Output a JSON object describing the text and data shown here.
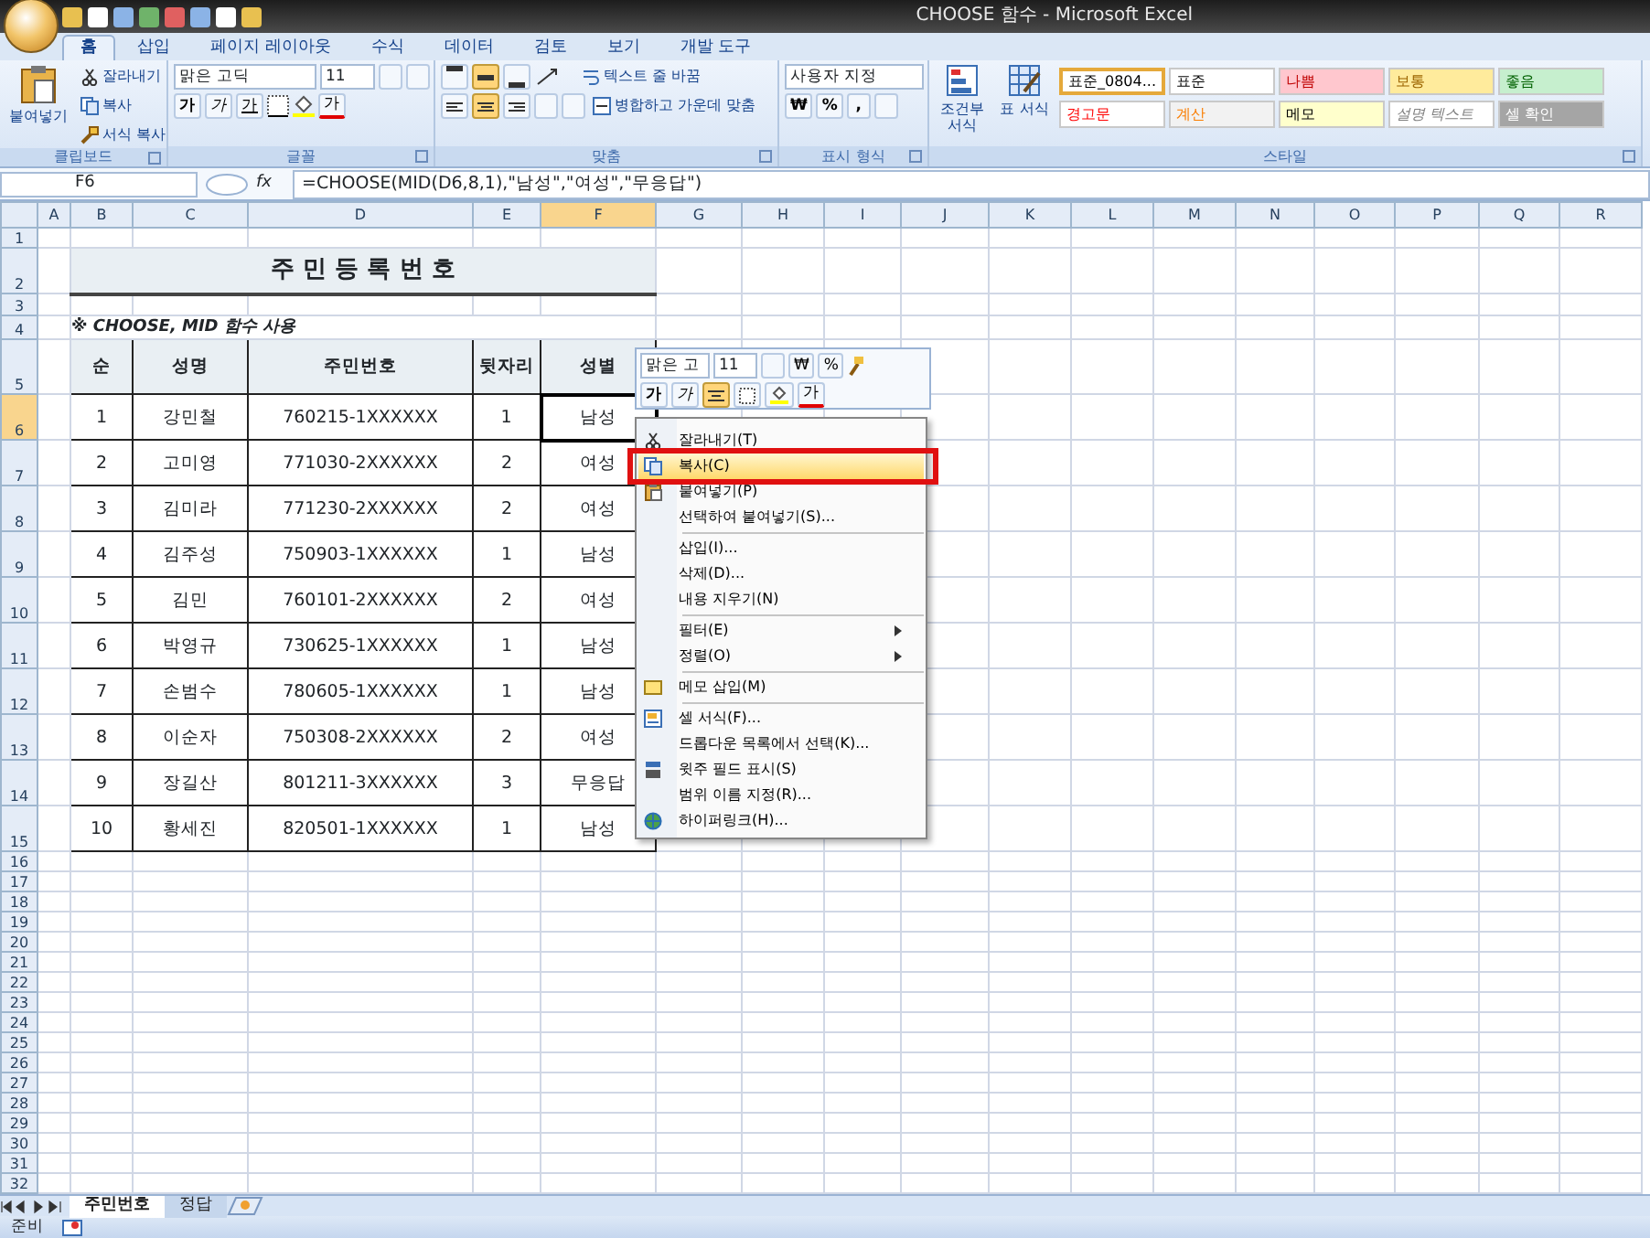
{
  "window": {
    "title": "CHOOSE 함수 - Microsoft Excel"
  },
  "ribbon_tabs": [
    {
      "label": "홈",
      "selected": true
    },
    {
      "label": "삽입",
      "selected": false
    },
    {
      "label": "페이지 레이아웃",
      "selected": false
    },
    {
      "label": "수식",
      "selected": false
    },
    {
      "label": "데이터",
      "selected": false
    },
    {
      "label": "검토",
      "selected": false
    },
    {
      "label": "보기",
      "selected": false
    },
    {
      "label": "개발 도구",
      "selected": false
    }
  ],
  "clipboard": {
    "label": "클립보드",
    "paste": "붙여넣기",
    "cut": "잘라내기",
    "copy": "복사",
    "format_painter": "서식 복사"
  },
  "font": {
    "label": "글꼴",
    "font_name": "맑은 고딕",
    "font_size": "11",
    "bold": "가",
    "italic": "가",
    "underline": "가",
    "font_color": "가"
  },
  "alignment": {
    "label": "맞춤",
    "vertical": [
      {
        "selected": false
      },
      {
        "selected": true
      },
      {
        "selected": false
      }
    ],
    "horizontal": [
      {
        "selected": false
      },
      {
        "selected": true
      },
      {
        "selected": false
      }
    ],
    "wrap": "텍스트 줄 바꿈",
    "merge": "병합하고 가운데 맞춤"
  },
  "number": {
    "label": "표시 형식",
    "format": "사용자 지정",
    "currency": "₩",
    "percent": "%",
    "comma": ","
  },
  "styles": {
    "label": "스타일",
    "conditional": "조건부 서식",
    "table_format": "표 서식",
    "tiles": [
      {
        "label": "표준_0804...",
        "kind": "normal",
        "color": "#ffffff",
        "selected": true
      },
      {
        "label": "표준",
        "kind": "normal",
        "color": "#ffffff",
        "selected": false
      },
      {
        "label": "나쁨",
        "kind": "bad",
        "color": "#ffc7ce",
        "selected": false
      },
      {
        "label": "보통",
        "kind": "neutral",
        "color": "#ffeb9c",
        "selected": false
      },
      {
        "label": "좋음",
        "kind": "good",
        "color": "#c6efce",
        "selected": false
      },
      {
        "label": "경고문",
        "kind": "warning",
        "color": "#ffffff",
        "selected": false
      },
      {
        "label": "계산",
        "kind": "calc",
        "color": "#f2f2f2",
        "selected": false
      },
      {
        "label": "메모",
        "kind": "note",
        "color": "#ffffcc",
        "selected": false
      },
      {
        "label": "설명 텍스트",
        "kind": "explain",
        "color": "#ffffff",
        "selected": false
      },
      {
        "label": "셀 확인",
        "kind": "check",
        "color": "#a5a5a5",
        "selected": false
      }
    ]
  },
  "formula_bar": {
    "name_box": "F6",
    "fx": "fx",
    "formula": "=CHOOSE(MID(D6,8,1),\"남성\",\"여성\",\"무응답\")"
  },
  "sheet": {
    "columns": [
      {
        "label": "A",
        "selected": false
      },
      {
        "label": "B",
        "selected": false
      },
      {
        "label": "C",
        "selected": false
      },
      {
        "label": "D",
        "selected": false
      },
      {
        "label": "E",
        "selected": false
      },
      {
        "label": "F",
        "selected": true
      },
      {
        "label": "G",
        "selected": false
      },
      {
        "label": "H",
        "selected": false
      },
      {
        "label": "I",
        "selected": false
      },
      {
        "label": "J",
        "selected": false
      },
      {
        "label": "K",
        "selected": false
      },
      {
        "label": "L",
        "selected": false
      },
      {
        "label": "M",
        "selected": false
      },
      {
        "label": "N",
        "selected": false
      },
      {
        "label": "O",
        "selected": false
      },
      {
        "label": "P",
        "selected": false
      },
      {
        "label": "Q",
        "selected": false
      },
      {
        "label": "R",
        "selected": false
      }
    ],
    "rows": [
      {
        "label": "1",
        "selected": false
      },
      {
        "label": "2",
        "selected": false
      },
      {
        "label": "3",
        "selected": false
      },
      {
        "label": "4",
        "selected": false
      },
      {
        "label": "5",
        "selected": false
      },
      {
        "label": "6",
        "selected": true
      },
      {
        "label": "7",
        "selected": false
      },
      {
        "label": "8",
        "selected": false
      },
      {
        "label": "9",
        "selected": false
      },
      {
        "label": "10",
        "selected": false
      },
      {
        "label": "11",
        "selected": false
      },
      {
        "label": "12",
        "selected": false
      },
      {
        "label": "13",
        "selected": false
      },
      {
        "label": "14",
        "selected": false
      },
      {
        "label": "15",
        "selected": false
      },
      {
        "label": "16",
        "selected": false
      },
      {
        "label": "17",
        "selected": false
      },
      {
        "label": "18",
        "selected": false
      },
      {
        "label": "19",
        "selected": false
      },
      {
        "label": "20",
        "selected": false
      },
      {
        "label": "21",
        "selected": false
      },
      {
        "label": "22",
        "selected": false
      },
      {
        "label": "23",
        "selected": false
      },
      {
        "label": "24",
        "selected": false
      },
      {
        "label": "25",
        "selected": false
      },
      {
        "label": "26",
        "selected": false
      },
      {
        "label": "27",
        "selected": false
      },
      {
        "label": "28",
        "selected": false
      },
      {
        "label": "29",
        "selected": false
      },
      {
        "label": "30",
        "selected": false
      },
      {
        "label": "31",
        "selected": false
      },
      {
        "label": "32",
        "selected": false
      }
    ],
    "title": "주 민 등 록 번 호",
    "note": "※ CHOOSE, MID 함수 사용",
    "table": {
      "columns": [
        "순",
        "성명",
        "주민번호",
        "뒷자리",
        "성별"
      ],
      "rows": [
        {
          "cells": [
            "1",
            "강민철",
            "760215-1XXXXXX",
            "1",
            "남성"
          ],
          "active": true
        },
        {
          "cells": [
            "2",
            "고미영",
            "771030-2XXXXXX",
            "2",
            "여성"
          ],
          "active": false
        },
        {
          "cells": [
            "3",
            "김미라",
            "771230-2XXXXXX",
            "2",
            "여성"
          ],
          "active": false
        },
        {
          "cells": [
            "4",
            "김주성",
            "750903-1XXXXXX",
            "1",
            "남성"
          ],
          "active": false
        },
        {
          "cells": [
            "5",
            "김민",
            "760101-2XXXXXX",
            "2",
            "여성"
          ],
          "active": false
        },
        {
          "cells": [
            "6",
            "박영규",
            "730625-1XXXXXX",
            "1",
            "남성"
          ],
          "active": false
        },
        {
          "cells": [
            "7",
            "손범수",
            "780605-1XXXXXX",
            "1",
            "남성"
          ],
          "active": false
        },
        {
          "cells": [
            "8",
            "이순자",
            "750308-2XXXXXX",
            "2",
            "여성"
          ],
          "active": false
        },
        {
          "cells": [
            "9",
            "장길산",
            "801211-3XXXXXX",
            "3",
            "무응답"
          ],
          "active": false
        },
        {
          "cells": [
            "10",
            "황세진",
            "820501-1XXXXXX",
            "1",
            "남성"
          ],
          "active": false
        }
      ]
    }
  },
  "mini_toolbar": {
    "font_name": "맑은 고",
    "font_size": "11",
    "currency": "₩",
    "percent": "%",
    "buttons": [
      {
        "kind": "bold",
        "label": "가",
        "selected": false
      },
      {
        "kind": "italic",
        "label": "가",
        "selected": false
      },
      {
        "kind": "center",
        "selected": true
      },
      {
        "kind": "border",
        "selected": false
      },
      {
        "kind": "fill",
        "selected": false
      },
      {
        "kind": "font-color",
        "label": "가",
        "selected": false
      }
    ]
  },
  "context_menu": [
    {
      "kind": "cut",
      "label": "잘라내기(T)",
      "selected": false,
      "outlined": false,
      "submenu": false
    },
    {
      "kind": "copy",
      "label": "복사(C)",
      "selected": true,
      "outlined": true,
      "submenu": false
    },
    {
      "kind": "paste",
      "label": "붙여넣기(P)",
      "selected": false,
      "outlined": false,
      "submenu": false
    },
    {
      "kind": "plain",
      "label": "선택하여 붙여넣기(S)...",
      "selected": false,
      "outlined": false,
      "submenu": false
    },
    {
      "kind": "separator"
    },
    {
      "kind": "plain",
      "label": "삽입(I)...",
      "selected": false,
      "outlined": false,
      "submenu": false
    },
    {
      "kind": "plain",
      "label": "삭제(D)...",
      "selected": false,
      "outlined": false,
      "submenu": false
    },
    {
      "kind": "plain",
      "label": "내용 지우기(N)",
      "selected": false,
      "outlined": false,
      "submenu": false
    },
    {
      "kind": "separator"
    },
    {
      "kind": "plain",
      "label": "필터(E)",
      "selected": false,
      "outlined": false,
      "submenu": true
    },
    {
      "kind": "plain",
      "label": "정렬(O)",
      "selected": false,
      "outlined": false,
      "submenu": true
    },
    {
      "kind": "separator"
    },
    {
      "kind": "comment",
      "label": "메모 삽입(M)",
      "selected": false,
      "outlined": false,
      "submenu": false
    },
    {
      "kind": "separator"
    },
    {
      "kind": "format",
      "label": "셀 서식(F)...",
      "selected": false,
      "outlined": false,
      "submenu": false
    },
    {
      "kind": "plain",
      "label": "드롭다운 목록에서 선택(K)...",
      "selected": false,
      "outlined": false,
      "submenu": false
    },
    {
      "kind": "phonetic",
      "label": "윗주 필드 표시(S)",
      "selected": false,
      "outlined": false,
      "submenu": false
    },
    {
      "kind": "plain",
      "label": "범위 이름 지정(R)...",
      "selected": false,
      "outlined": false,
      "submenu": false
    },
    {
      "kind": "link",
      "label": "하이퍼링크(H)...",
      "selected": false,
      "outlined": false,
      "submenu": false
    }
  ],
  "sheet_tabs": [
    {
      "label": "주민번호",
      "selected": true
    },
    {
      "label": "정답",
      "selected": false
    }
  ],
  "status_bar": {
    "text": "준비"
  }
}
